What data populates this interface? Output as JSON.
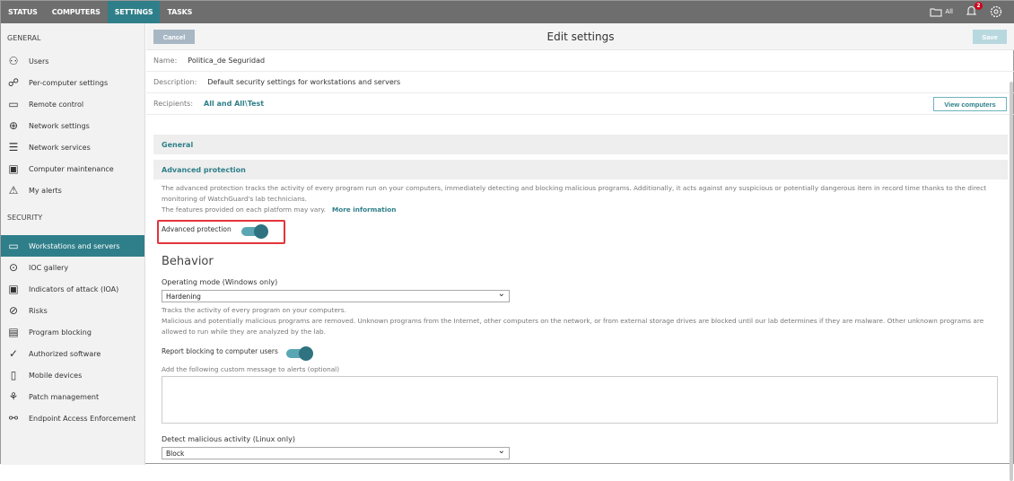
{
  "topbar": {
    "tabs": [
      "STATUS",
      "COMPUTERS",
      "SETTINGS",
      "TASKS"
    ],
    "active": "SETTINGS",
    "folder_label": "All",
    "notifications": "2"
  },
  "sidebar": {
    "general_title": "GENERAL",
    "general": [
      "Users",
      "Per-computer settings",
      "Remote control",
      "Network settings",
      "Network services",
      "Computer maintenance",
      "My alerts"
    ],
    "security_title": "SECURITY",
    "security": [
      "Workstations and servers",
      "IOC gallery",
      "Indicators of attack (IOA)",
      "Risks",
      "Program blocking",
      "Authorized software",
      "Mobile devices",
      "Patch management",
      "Endpoint Access Enforcement"
    ]
  },
  "header": {
    "cancel": "Cancel",
    "title": "Edit settings",
    "save": "Save"
  },
  "form": {
    "name_label": "Name:",
    "name": "Politica_de Seguridad",
    "desc_label": "Description:",
    "desc": "Default security settings for workstations and servers",
    "recip_label": "Recipients:",
    "recip": "All and All\\Test",
    "view": "View computers"
  },
  "sections": {
    "general": "General",
    "advanced": "Advanced protection"
  },
  "advanced": {
    "desc1": "The advanced protection tracks the activity of every program run on your computers, immediately detecting and blocking malicious programs. Additionally, it acts against any suspicious or potentially dangerous item in record time thanks to the direct",
    "desc2": "monitoring of WatchGuard's lab technicians.",
    "desc3": "The features provided on each platform may vary.",
    "more": "More information",
    "toggle_label": "Advanced protection"
  },
  "behavior": {
    "title": "Behavior",
    "mode_label": "Operating mode (Windows only)",
    "mode_value": "Hardening",
    "mode_desc1": "Tracks the activity of every program on your computers.",
    "mode_desc2": "Malicious and potentially malicious programs are removed. Unknown programs from the Internet, other computers on the network, or from external storage drives are blocked until our lab determines if they are malware. Other unknown programs are",
    "mode_desc3": "allowed to run while they are analyzed by the lab.",
    "report_label": "Report blocking to computer users",
    "custom_msg_label": "Add the following custom message to alerts (optional)",
    "linux_label": "Detect malicious activity (Linux only)",
    "linux_value": "Block"
  }
}
